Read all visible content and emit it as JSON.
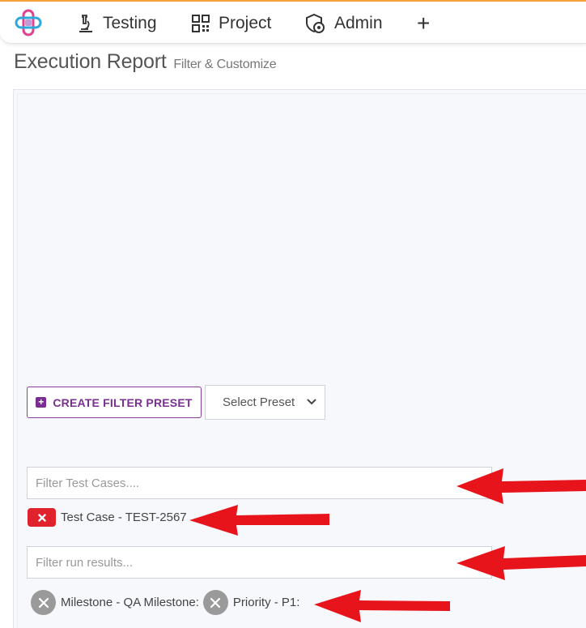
{
  "nav": {
    "items": [
      {
        "label": "Testing",
        "icon": "microscope-icon"
      },
      {
        "label": "Project",
        "icon": "qr-grid-icon"
      },
      {
        "label": "Admin",
        "icon": "shield-gear-icon"
      }
    ],
    "add_label": "+"
  },
  "page": {
    "title": "Execution Report",
    "subtitle": "Filter & Customize"
  },
  "presets": {
    "create_label": "CREATE FILTER PRESET",
    "select_label": "Select Preset"
  },
  "filters": {
    "cases_placeholder": "Filter Test Cases....",
    "case_chips": [
      "Test Case - TEST-2567"
    ],
    "runs_placeholder": "Filter run results...",
    "run_chips": [
      "Milestone - QA Milestone:",
      "Priority - P1:"
    ]
  },
  "colors": {
    "accent_purple": "#7b2d93",
    "chip_red": "#e0222c",
    "annotation_arrow": "#e8141b",
    "topbar_accent": "#f2a23a"
  }
}
